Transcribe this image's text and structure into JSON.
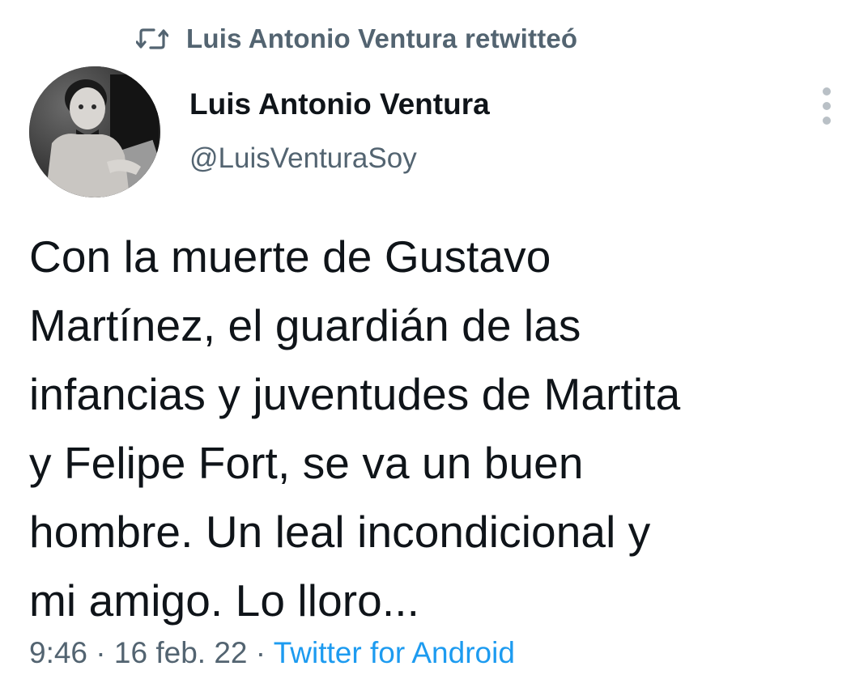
{
  "retweet": {
    "icon": "retweet-icon",
    "text": "Luis Antonio Ventura retwitteó"
  },
  "author": {
    "display_name": "Luis Antonio Ventura",
    "handle": "@LuisVenturaSoy",
    "avatar_icon": "profile-photo"
  },
  "more_icon": "more-vertical-icon",
  "tweet": {
    "lines": [
      "Con la muerte de Gustavo",
      "Martínez, el guardián de las",
      "infancias y juventudes de Martita",
      "y Felipe Fort, se va un buen",
      "hombre. Un leal incondicional y",
      "mi amigo. Lo lloro..."
    ]
  },
  "meta": {
    "time": "9:46",
    "separator1": " · ",
    "date": "16 feb. 22",
    "separator2": " · ",
    "source": "Twitter for Android"
  },
  "colors": {
    "text_primary": "#0f1419",
    "text_secondary": "#536471",
    "link": "#1d9bf0"
  }
}
